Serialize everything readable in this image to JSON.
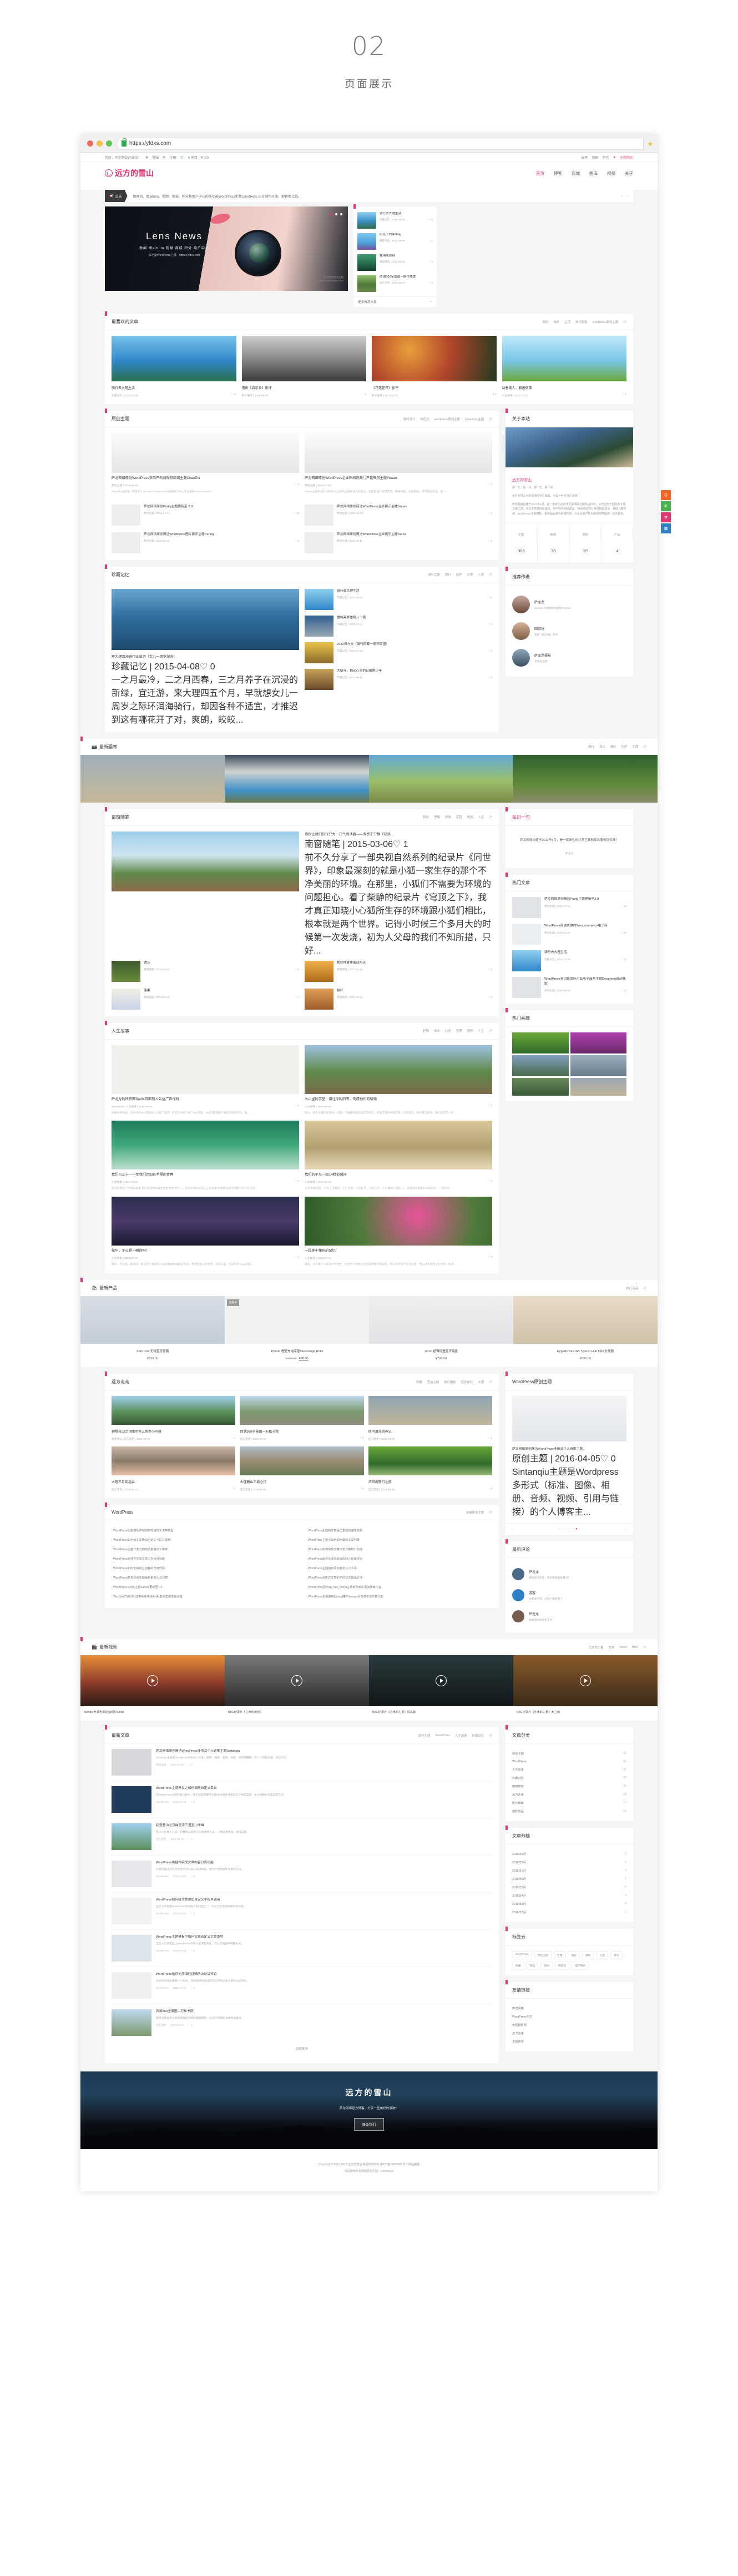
{
  "intro": {
    "number": "02",
    "subtitle": "页面展示"
  },
  "browser": {
    "url": "https://yfdxs.com",
    "lock_icon": "lock-icon",
    "star_icon": "star-icon",
    "dots": [
      "#ec6a5e",
      "#f4c04e",
      "#61c454"
    ]
  },
  "topbar": {
    "greeting": "您好，欢迎您访问本站！",
    "login": "登陆",
    "register": "注册",
    "cart": "0 项目 - ¥0.00",
    "right": [
      "标签",
      "相册",
      "留言",
      "主题购买"
    ]
  },
  "site": {
    "logo": "远方的雪山",
    "nav": [
      "首页",
      "博客",
      "商城",
      "图库",
      "视频",
      "关于"
    ]
  },
  "notice": {
    "tag": "公告",
    "text": "新闻风、图album、视频、商城、积分和用户中心的多功能WordPress主题LensNews 正在制作开发，即将新上线。"
  },
  "hero": {
    "title": "Lens News",
    "line2": "新闻 图album 视频 商城 积分 用户中心",
    "line3": "多功能WordPress主题：https://yfdxs.com",
    "credit_line1": "萨龙网络原创主题",
    "credit_line2": "https://salongweb.com"
  },
  "hero_side": {
    "items": [
      {
        "title": "骑行去大理生活",
        "cat": "珍藏记忆",
        "date": "2014-10-25",
        "likes": "12",
        "color": "#4aa3dd"
      },
      {
        "title": "阳光下的牵牛花",
        "cat": "摄影作品",
        "date": "2013-09-30",
        "likes": "1",
        "color": "#5bb7e8"
      },
      {
        "title": "在海底告别",
        "cat": "南窗随笔",
        "date": "2013-08-28",
        "likes": "0",
        "color": "#2f7a4f"
      },
      {
        "title": "西湖360全景图—断桥残雪",
        "cat": "远方走走",
        "date": "2013-08-13",
        "likes": "0",
        "color": "#6b8a4a"
      }
    ],
    "more": "更多推荐文章"
  },
  "sections": {
    "favorite": {
      "title": "最喜欢的文章",
      "cats": [
        "简约",
        "电影",
        "生活",
        "旅行摄影",
        "wordpress原创主题"
      ],
      "cards": [
        {
          "title": "骑行去大理生活",
          "cat": "珍藏记忆",
          "date": "2014-10-25",
          "likes": "12",
          "color": "#3d96d6"
        },
        {
          "title": "电影《启示录》影评",
          "cat": "影片推荐",
          "date": "2016-05-06",
          "likes": "4",
          "color": "#9d9d9d"
        },
        {
          "title": "《花落花开》影评",
          "cat": "影片推荐",
          "date": "2013-12-31",
          "likes": "2",
          "color": "#b3452b"
        },
        {
          "title": "站着做人，躺着做事",
          "cat": "人生故事",
          "date": "2012-10-22",
          "likes": "1",
          "color": "#79c6e8"
        }
      ]
    },
    "original": {
      "title": "原创主题",
      "cats": [
        "简约设计",
        "响应式",
        "wordpress原创主题",
        "Deephoto主题"
      ],
      "big": [
        {
          "title": "萨龙网络原创WordPress多用户新闻视频商城主题ChanZhi",
          "cat": "原创主题",
          "date": "2016-09-23",
          "likes": "4",
          "desc": "ChanZhi主题是一款集成了wp-user-frontend-pro前端用户中心专业版和WooCommerc..."
        },
        {
          "title": "萨龙网络原创WordPress企业新闻视频门户昆虫测主题Yewan",
          "cat": "原创主题",
          "date": "2016-07-15",
          "likes": "2",
          "desc": "Yewan主题的设计与制作与之前的主题有很大的变化，页面的设计依然简洁，布局新颖，功能稍微，细节更加突出，是一..."
        }
      ],
      "small": [
        {
          "title": "萨龙网络原创Purity主题更新至 3.0",
          "cat": "原创主题",
          "date": "2016-07-01",
          "likes": "19"
        },
        {
          "title": "萨龙网络原创简洁WordPress企业展示主题Squan",
          "cat": "原创主题",
          "date": "2016-05-22",
          "likes": "1"
        },
        {
          "title": "萨龙网络原创简洁WordPress图片展示主题Pering",
          "cat": "原创主题",
          "date": "2016-06-02",
          "likes": "0"
        },
        {
          "title": "萨龙网络原创简洁WordPress企业展示主题Sansi",
          "cat": "原创主题",
          "date": "2016-05-14",
          "likes": "1"
        }
      ]
    },
    "memory": {
      "title": "珍藏记忆",
      "cats": [
        "骑行之旅",
        "旅行",
        "拉萨",
        "大理",
        "人生"
      ],
      "featured": {
        "title": "环大理耳海骑行三日游（女儿一周岁纪念）",
        "cat": "珍藏记忆",
        "date": "2015-04-08",
        "likes": "0",
        "desc": "一之月最冷，二之月西春，三之月养子在沉浸的新绿，宜迁游，来大理四五个月，早就想女儿一周岁之际环洱海骑行，却因各种不适宜，才推迟到这有哪花开了对，爽朗，皎皎..."
      },
      "list": [
        {
          "title": "骑行去大理生活",
          "cat": "珍藏记忆",
          "date": "2014-10-25",
          "likes": "12"
        },
        {
          "title": "雪域高原重镇八一镇",
          "cat": "珍藏记忆",
          "date": "2013-03-01",
          "likes": "0"
        },
        {
          "title": "2012得与失（骑行西藏一周年回望）",
          "cat": "珍藏记忆",
          "date": "2012-11-21",
          "likes": "1"
        },
        {
          "title": "大昭寺，触动心灵的日暖刚少年",
          "cat": "珍藏记忆",
          "date": "2012-09-14",
          "likes": "0"
        }
      ]
    },
    "about": {
      "title": "关于本站",
      "heading": "远方的雪山",
      "tagline": "那一天，那一月，那一年，那一世...",
      "p1": "远方的雪山为萨龙网络官方博客，分享一些美好的事物！",
      "p2": "萨龙网络始建于2012年4月，是一家新生的优秀互联网综合服务提供商，公司业务于国际的大理其海之滨，专注于高端网站建设、电子商务网站建设、移动网站预订系统网站建设、移动互联应用、WordPress主题模板、服务器品牌与网站托管，为企业客户的互联网应用提供一站式服务。",
      "stats": [
        {
          "k": "文章",
          "v": "306"
        },
        {
          "k": "画廊",
          "v": "33"
        },
        {
          "k": "视频",
          "v": "19"
        },
        {
          "k": "产品",
          "v": "4"
        }
      ]
    },
    "authors": {
      "title": "推荐作者",
      "list": [
        {
          "name": "萨龙龙",
          "desc": "Blender开源电影动画短片Sintel",
          "color": "#7a5c4e"
        },
        {
          "name": "四叔秋",
          "desc": "电影《启示录》影评",
          "color": "#8a6b55"
        },
        {
          "name": "萨龙龙摄影",
          "desc": "洱海边远望",
          "color": "#4a6070"
        }
      ]
    },
    "gallery": {
      "title": "最新画廊",
      "icon": "camera-icon",
      "cats": [
        "骑行",
        "苍山",
        "婚纱",
        "拉萨",
        "大理"
      ],
      "colors": [
        "#8fa2ac",
        "#6f8ba6",
        "#63a8d6",
        "#3f7a42"
      ]
    },
    "essay": {
      "title": "南窗随笔",
      "cats": [
        "韩化",
        "思绪",
        "抒情",
        "花园",
        "啤酒",
        "人生"
      ],
      "featured": {
        "title": "请别让我们仅仅只为一口气而活着——有感于宁静《穹顶...",
        "cat": "南窗随笔",
        "date": "2015-03-06",
        "likes": "1",
        "desc": "前不久分享了一部央视自然系列的纪录片《同世界》，印象最深刻的就是小狐一家生存的那个不净美丽的环境。在那里，小狐们不需要为环境的问题担心。看了柴静的纪录片《穹顶之下》，我才真正知晓小心狐所生存的环境跟小狐们相比，根本就是两个世界。记得小时候三个多月大的时候第一次发烧，初为人父母的我们不知所措，只好..."
      },
      "grid": [
        {
          "title": "遗忘",
          "cat": "南窗随笔",
          "date": "2013-12-10",
          "likes": "0",
          "color": "#3e5a2e"
        },
        {
          "title": "我在仲夏里偷窃阳光",
          "cat": "南窗随笔",
          "date": "2013-11-12",
          "likes": "1",
          "color": "#d9892c"
        },
        {
          "title": "落果",
          "cat": "南窗随笔",
          "date": "2013-10-20",
          "likes": "1",
          "color": "#e8e3d4"
        },
        {
          "title": "秸秆",
          "cat": "南窗随笔",
          "date": "2013-09-15",
          "likes": "0",
          "color": "#c98744"
        }
      ]
    },
    "daily": {
      "title": "每日一句",
      "text": "萨龙网络始建于2012年8月，是一家新生的优秀互联网综合服务提供商！",
      "by": "萨龙龙"
    },
    "hot_posts": {
      "title": "热门文章",
      "list": [
        {
          "title": "萨龙网络原创简洁Purity主题更新至3.0",
          "cat": "原创主题",
          "date": "2016-07-01",
          "likes": "19"
        },
        {
          "title": "WordPress简洁优雅的Woocommerce电子商",
          "cat": "原创主题",
          "date": "2015-02-04",
          "likes": "16"
        },
        {
          "title": "骑行去大理生活",
          "cat": "珍藏记忆",
          "date": "2014-10-25",
          "likes": "12"
        },
        {
          "title": "WordPress多功能国际企业电子商务主题Deephoto自动获取",
          "cat": "原创主题",
          "date": "2015-09-28",
          "likes": "12"
        }
      ]
    },
    "life": {
      "title": "人生故事",
      "cats": [
        "抒情",
        "成长",
        "心灵",
        "哲理",
        "感悟",
        "人生"
      ],
      "cards": [
        {
          "title": "萨龙龙的所有网站404页面加入公益广告代码",
          "cat": "Wordpress, 人生故事",
          "date": "2015-05-01",
          "likes": "0",
          "desc": "如果你有网站，也为你的404页面加入公益广告吧！前页见归来了解下404页面，404页面是用户端在浏览网页时，是...",
          "color": "#e3e7e0"
        },
        {
          "title": "大山里的学堂：请让你的旧书，变成他们的新知",
          "cat": "人生故事",
          "date": "2015-04-03",
          "likes": "1",
          "desc": "旗山，南京古国的发源地，也是一个幽静和国际全景的地方，有着丰富的中国印象，历史悠久，即也有因败旧，我们选求的一所...",
          "color": "#7ba05b"
        },
        {
          "title": "我们已三十——至我们仍旧在手里的青春",
          "cat": "人生故事",
          "date": "2015-03-01",
          "likes": "0",
          "desc": "还记得那些个年轻的夜里 我们在夏季的夜空里星星和村村 一一次次失望的功夫忘在生命里 好像再也抓不住那个年少轻狂的...",
          "color": "#1f7a5a"
        },
        {
          "title": "我们的平凡—2014精彩瞬间",
          "cat": "人生故事",
          "date": "2015-02-18",
          "likes": "0",
          "desc": "'五月苹果空蕊，六月芬芳振羽，七月在野，八月在宇，九月在户，十月蟋蟀入我床下。'这是诗经里最朴实的句子，一年的光...",
          "color": "#c9b27f"
        },
        {
          "title": "繁华，不过是一瞬间吗！",
          "cat": "人生故事",
          "date": "2013-12-05",
          "likes": "1",
          "desc": "繁华，不过是一瞬间吗！看过这个故事的人通常都能够理解这句话，希望您能认真思考、多可以前，在旧的的Yoga间里...",
          "color": "#2b2c4e"
        },
        {
          "title": "一段关于槐花的记忆",
          "cat": "人生故事",
          "date": "2013-09-20",
          "likes": "0",
          "desc": "槐花，对于每个人来说并不陌生，生活中大多数公众品是用槐花制成的，所以亦平常不会太在意，而在萨龙龙的记忆中有一段关...",
          "color": "#4f7a3a"
        }
      ]
    },
    "hot_gallery": {
      "title": "热门画廊",
      "colors": [
        "#4f8f3a",
        "#a23fa0",
        "#6b8fb0",
        "#8da3ad",
        "#5a7a52",
        "#8a9aa4"
      ]
    },
    "products": {
      "title": "最新产品",
      "icon": "bag-icon",
      "cats": [
        "热门商品"
      ],
      "items": [
        {
          "name": "Solo One 无线蓝牙音箱",
          "price": "¥599.00",
          "sale": "",
          "badge": "",
          "color": "#cdd4dc"
        },
        {
          "name": "iPhone 墙壁充电底座Bluelounge Rollo",
          "price": "¥68.00",
          "sale": "¥120.00",
          "badge": "促销中",
          "color": "#f0f0f0"
        },
        {
          "name": "Jorno 超薄折叠蓝牙键盘",
          "price": "¥798.00",
          "sale": "",
          "badge": "",
          "color": "#ececee"
        },
        {
          "name": "HyperDrive USB Type-C Hub 5合1分线器",
          "price": "¥599.00",
          "sale": "",
          "badge": "",
          "color": "#e2dbd0"
        }
      ]
    },
    "travel": {
      "title": "远方走走",
      "cats": [
        "西藏",
        "苍山之巅",
        "旅行摄影",
        "徒步旅行",
        "大理"
      ],
      "cards": [
        {
          "title": "初登苍山之顶曲至寺三塔至小岑峰",
          "cat": "徒步登山, 远方走走",
          "date": "2016-08-16",
          "likes": "1",
          "color": "#5b8f5b"
        },
        {
          "title": "西湖360全景图—万松书院",
          "cat": "远方走走",
          "date": "2016-03-16",
          "likes": "0",
          "color": "#7d9a6e"
        },
        {
          "title": "修河洱海游神记",
          "cat": "远方走走",
          "date": "2016-03-06",
          "likes": "1",
          "color": "#8fa5b2"
        },
        {
          "title": "大理三月街庙会",
          "cat": "远方走走",
          "date": "2016-01-22",
          "likes": "0",
          "color": "#b0a090"
        },
        {
          "title": "大理巍山古城之行",
          "cat": "远方走走",
          "date": "2015-08-04",
          "likes": "0",
          "color": "#9a8c74"
        },
        {
          "title": "洱阳湖骑行之旅",
          "cat": "远方走走",
          "date": "2014-09-19",
          "likes": "0",
          "color": "#4f8a3a"
        }
      ]
    },
    "wp_theme": {
      "title": "WordPress原创主题",
      "item": {
        "title": "萨龙网络原创简洁WordPress多形式个人诗集主题...",
        "cat": "原创主题",
        "date": "2016-04-05",
        "likes": "0",
        "desc": "Sintanqiu主题是Wordpress多形式（标准、图像、相册、音频、视频、引用与链接）的个人博客主..."
      }
    },
    "comments": {
      "title": "最新评论",
      "list": [
        {
          "name": "萨龙龙",
          "text": "感谢您的支持，有问题请联系我们！",
          "color": "#4a6a8a"
        },
        {
          "name": "游客",
          "text": "主题很不错，已经下载使用了",
          "color": "#2f7fc7"
        },
        {
          "name": "萨龙龙",
          "text": "谢谢您的关注和支持！",
          "color": "#7a5c4e"
        }
      ]
    },
    "wp_links": {
      "title": "WordPress",
      "more": "查看更多文章",
      "left": [
        "WordPress主题模板中如何实现自定义文章类型",
        "WordPress如何给文章添加自定义字段并调用",
        "WordPress主题开发之如何调用自定义菜单",
        "WordPress免插件实现文章内容分页功能",
        "WordPress如何去掉前台加载的无用代码",
        "WordPress萨龙原创主题最新更新汇总列表",
        "WordPress CMS主题Salong更新至1.4",
        "WebSvg开通SSL证书免费申请AH后主机需要安装设置"
      ],
      "right": [
        "WordPress主题制作教程之主题的基本结构",
        "WordPress主题中如何调用最新文章列表",
        "WordPress如何实现文章浏览次数统计功能",
        "WordPress给评论添加验证码防止垃圾评论",
        "WordPress主题如何添加自定义小工具",
        "WordPress多形式文章的不同样式输出方法",
        "WordPress函数wp_nav_menu在菜单列表中添加搜索内容",
        "WordPress主题使用jQuery插件Isotope添加瀑布流布局功能"
      ]
    },
    "videos": {
      "title": "最新视频",
      "icon": "video-icon",
      "cats": [
        "艺术的力量",
        "生命",
        "Sintel",
        "BBC"
      ],
      "items": [
        {
          "title": "Blender开源电影动画短片Sintel",
          "color": "#c97a3a"
        },
        {
          "title": "BBC纪录片《生命的奇迹》",
          "color": "#5a5a5a"
        },
        {
          "title": "BBC纪录片《艺术的力量》梵高篇",
          "color": "#1e2a2c"
        },
        {
          "title": "BBC纪录片《艺术的力量》大卫篇",
          "color": "#6b4a2a"
        }
      ]
    },
    "blog": {
      "title": "最新文章",
      "cats": [
        "原创主题",
        "WordPress",
        "人生故事",
        "珍藏记忆"
      ],
      "posts": [
        {
          "title": "萨龙网络原创简洁WordPress多形式个人诗集主题Sintanqiu",
          "desc": "Sintanqiu主题是Wordpress多形式（标准、图像、相册、音频、视频、引用与链接）的个人博客主题，简洁大方。",
          "cat": "原创主题",
          "date": "2016-04-05",
          "likes": "0",
          "color": "#d8d8dc"
        },
        {
          "title": "WordPress主题开发之如何调用自定义菜单",
          "desc": "在WordPress主题开发过程中，我们经常需要在主题中注册并调用自定义导航菜单，本文详细介绍其实现方法。",
          "cat": "WordPress",
          "date": "2016-03-28",
          "likes": "2",
          "color": "#1f3a5a"
        },
        {
          "title": "初登苍山之顶曲至寺三塔至小岑峰",
          "desc": "苍山十九峰十八溪，初登苍山选择了从感通寺上山，一路风景秀丽，值得记录。",
          "cat": "远方走走",
          "date": "2016-08-16",
          "likes": "1",
          "color": "#5b8f5b"
        },
        {
          "title": "WordPress免插件实现文章内容分页功能",
          "desc": "文章内容过长时分页显示可以提升阅读体验，本文介绍免插件实现的方法。",
          "cat": "WordPress",
          "date": "2016-02-20",
          "likes": "3",
          "color": "#e8e8ec"
        },
        {
          "title": "WordPress如何给文章添加自定义字段并调用",
          "desc": "自定义字段是WordPress非常强大的功能之一，可以为文章添加额外的信息。",
          "cat": "WordPress",
          "date": "2016-02-05",
          "likes": "1",
          "color": "#f0f2f4"
        },
        {
          "title": "WordPress主题模板中如何实现自定义文章类型",
          "desc": "自定义文章类型让WordPress不再只是博客系统，可以构建各种内容站点。",
          "cat": "WordPress",
          "date": "2016-01-18",
          "likes": "0",
          "color": "#dde4ea"
        },
        {
          "title": "WordPress给评论添加验证码防止垃圾评论",
          "desc": "垃圾评论困扰着每一个站长，添加简单的验证码可以有效过滤大部分垃圾评论。",
          "cat": "WordPress",
          "date": "2015-12-30",
          "likes": "2",
          "color": "#eef0f2"
        },
        {
          "title": "西湖360全景图—万松书院",
          "desc": "使用全景技术记录西湖万松书院的美丽景色，让远方的朋友也能身临其境。",
          "cat": "远方走走",
          "date": "2016-03-16",
          "likes": "0",
          "color": "#7d9a6e"
        }
      ],
      "more": "加载更多"
    },
    "side_cats": {
      "title": "文章分类",
      "list": [
        {
          "n": "原创主题",
          "c": "32"
        },
        {
          "n": "WordPress",
          "c": "86"
        },
        {
          "n": "人生故事",
          "c": "41"
        },
        {
          "n": "珍藏记忆",
          "c": "23"
        },
        {
          "n": "南窗随笔",
          "c": "35"
        },
        {
          "n": "远方走走",
          "c": "28"
        },
        {
          "n": "影片推荐",
          "c": "17"
        },
        {
          "n": "摄影作品",
          "c": "12"
        }
      ]
    },
    "side_archive": {
      "title": "文章归档",
      "list": [
        {
          "n": "2016年9月",
          "c": "3"
        },
        {
          "n": "2016年8月",
          "c": "5"
        },
        {
          "n": "2016年7月",
          "c": "4"
        },
        {
          "n": "2016年6月",
          "c": "2"
        },
        {
          "n": "2016年5月",
          "c": "6"
        },
        {
          "n": "2016年4月",
          "c": "3"
        },
        {
          "n": "2016年3月",
          "c": "4"
        },
        {
          "n": "2016年2月",
          "c": "2"
        }
      ]
    },
    "side_tags": {
      "title": "标签云",
      "tags": [
        "WordPress",
        "原创主题",
        "大理",
        "骑行",
        "摄影",
        "人生",
        "旅行",
        "西藏",
        "苍山",
        "简约",
        "响应式",
        "电子商务"
      ]
    },
    "side_links": {
      "title": "友情链接",
      "list": [
        "萨龙网络",
        "WordPress中文",
        "大理摄影网",
        "远方走走",
        "主题购买"
      ]
    }
  },
  "footer": {
    "title": "远方的雪山",
    "tagline": "萨龙网络官方博客，分享一些美好的事物！",
    "button": "联系我们",
    "copyright": "Copyright © 2012-2016 远方的雪山 保留所有权利   滇ICP备16003941号-7   网站地图",
    "theme_note": "本站使用萨龙网络原创主题：LensNews"
  },
  "float_tools": [
    {
      "icon": "qq-icon",
      "color": "#f26522"
    },
    {
      "icon": "wechat-icon",
      "color": "#4caf50"
    },
    {
      "icon": "weibo-icon",
      "color": "#e2376e"
    },
    {
      "icon": "qrcode-icon",
      "color": "#2f7fc7"
    }
  ]
}
